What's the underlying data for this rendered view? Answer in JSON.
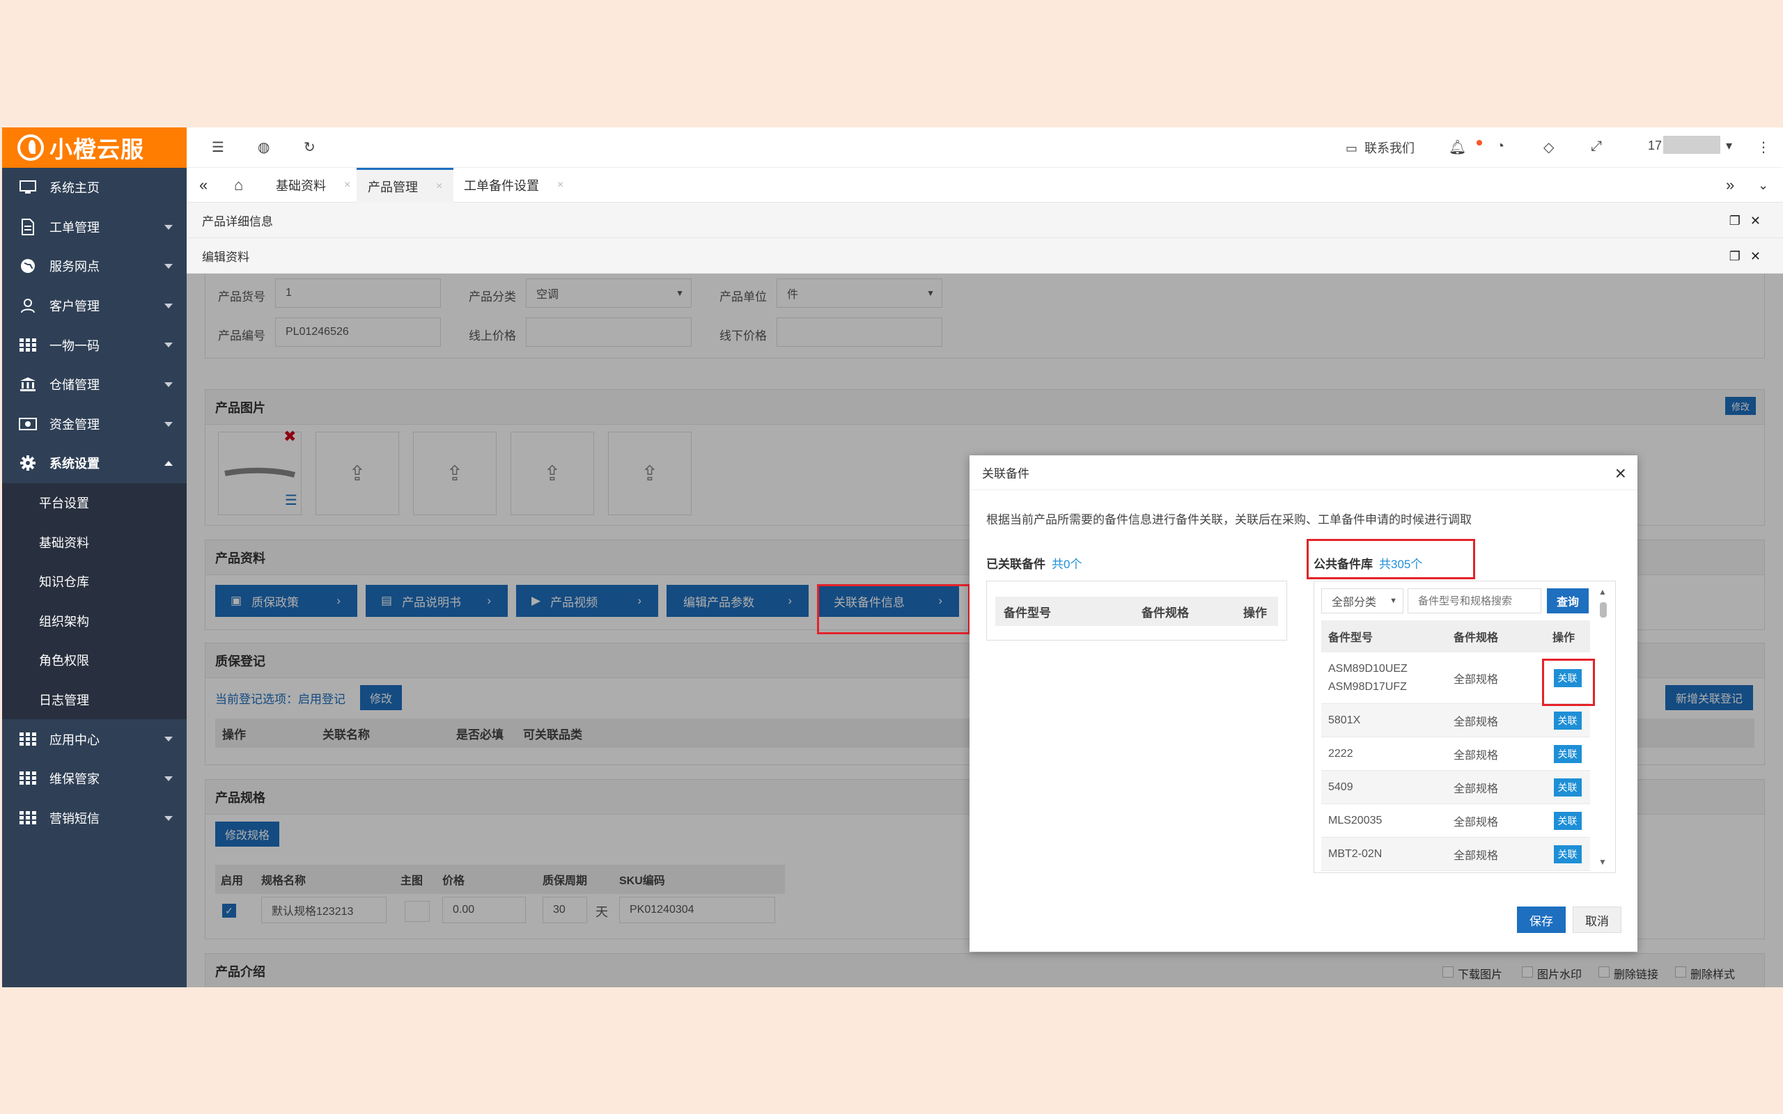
{
  "sidebar": {
    "logo": "小橙云服",
    "items": [
      {
        "label": "系统主页",
        "icon": "monitor-icon"
      },
      {
        "label": "工单管理",
        "icon": "document-icon"
      },
      {
        "label": "服务网点",
        "icon": "globe-icon"
      },
      {
        "label": "客户管理",
        "icon": "user-icon"
      },
      {
        "label": "一物一码",
        "icon": "grid-icon"
      },
      {
        "label": "仓储管理",
        "icon": "bank-icon"
      },
      {
        "label": "资金管理",
        "icon": "money-icon"
      },
      {
        "label": "系统设置",
        "icon": "gear-icon"
      }
    ],
    "sub": [
      "平台设置",
      "基础资料",
      "知识仓库",
      "组织架构",
      "角色权限",
      "日志管理"
    ],
    "items2": [
      {
        "label": "应用中心",
        "icon": "grid-icon"
      },
      {
        "label": "维保管家",
        "icon": "grid-icon"
      },
      {
        "label": "营销短信",
        "icon": "grid-icon"
      }
    ]
  },
  "topbar": {
    "contact": "联系我们",
    "user": "17"
  },
  "tabs": [
    "基础资料",
    "产品管理",
    "工单备件设置"
  ],
  "panels": {
    "detail": "产品详细信息",
    "edit": "编辑资料"
  },
  "form": {
    "goods_no_label": "产品货号",
    "goods_no": "1",
    "category_label": "产品分类",
    "category": "空调",
    "unit_label": "产品单位",
    "unit": "件",
    "code_label": "产品编号",
    "code": "PL01246526",
    "online_label": "线上价格",
    "offline_label": "线下价格"
  },
  "images": {
    "title": "产品图片",
    "modify": "修改"
  },
  "materials": {
    "title": "产品资料",
    "buttons": [
      "质保政策",
      "产品说明书",
      "产品视频",
      "编辑产品参数",
      "关联备件信息"
    ]
  },
  "warranty": {
    "title": "质保登记",
    "current": "当前登记选项：启用登记",
    "modify": "修改",
    "add": "新增关联登记",
    "headers": [
      "操作",
      "关联名称",
      "是否必填",
      "可关联品类"
    ]
  },
  "spec": {
    "title": "产品规格",
    "modify": "修改规格",
    "headers": [
      "启用",
      "规格名称",
      "主图",
      "价格",
      "质保周期",
      "SKU编码"
    ],
    "row": {
      "name": "默认规格123213",
      "price": "0.00",
      "period": "30",
      "unit": "天",
      "sku": "PK01240304"
    }
  },
  "intro": {
    "title": "产品介绍",
    "options": [
      "下载图片",
      "图片水印",
      "删除链接",
      "删除样式"
    ]
  },
  "modal": {
    "title": "关联备件",
    "desc": "根据当前产品所需要的备件信息进行备件关联，关联后在采购、工单备件申请的时候进行调取",
    "linked": {
      "title": "已关联备件",
      "count": "共0个",
      "headers": [
        "备件型号",
        "备件规格",
        "操作"
      ]
    },
    "public": {
      "title": "公共备件库",
      "count": "共305个",
      "filter": "全部分类",
      "search_placeholder": "备件型号和规格搜索",
      "query": "查询",
      "headers": [
        "备件型号",
        "备件规格",
        "操作"
      ],
      "rows": [
        {
          "model": "ASM89D10UEZ ASM98D17UFZ",
          "spec": "全部规格",
          "action": "关联"
        },
        {
          "model": "5801X",
          "spec": "全部规格",
          "action": "关联"
        },
        {
          "model": "2222",
          "spec": "全部规格",
          "action": "关联"
        },
        {
          "model": "5409",
          "spec": "全部规格",
          "action": "关联"
        },
        {
          "model": "MLS20035",
          "spec": "全部规格",
          "action": "关联"
        },
        {
          "model": "MBT2-02N",
          "spec": "全部规格",
          "action": "关联"
        }
      ]
    },
    "save": "保存",
    "cancel": "取消"
  }
}
